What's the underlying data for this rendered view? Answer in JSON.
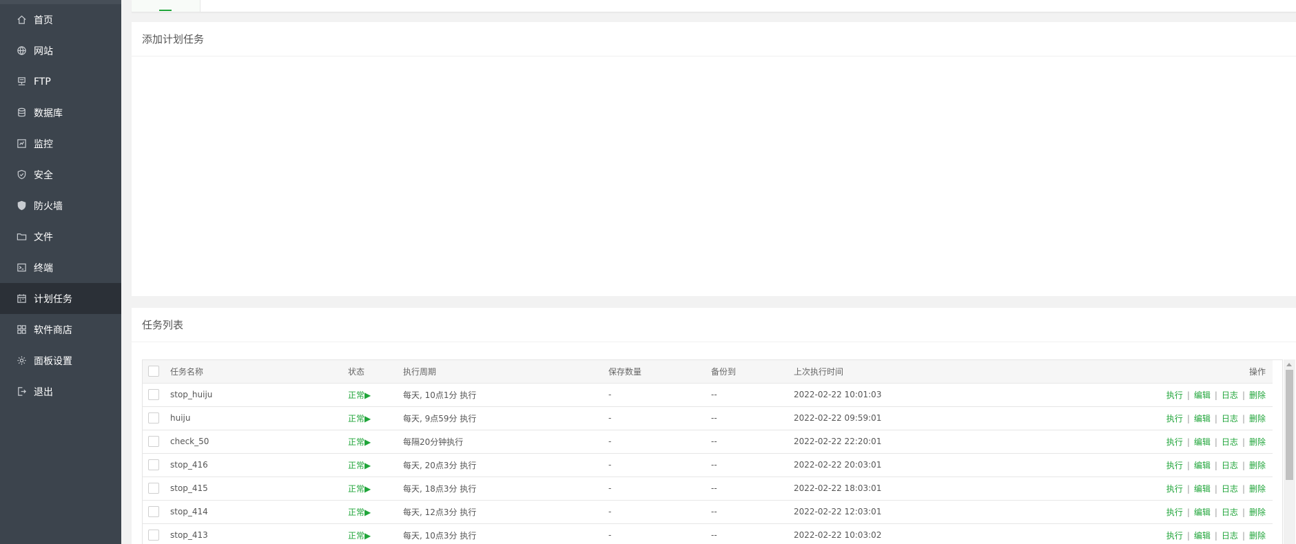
{
  "sidebar": {
    "items": [
      {
        "label": "首页",
        "icon": "home-icon"
      },
      {
        "label": "网站",
        "icon": "globe-icon"
      },
      {
        "label": "FTP",
        "icon": "ftp-icon"
      },
      {
        "label": "数据库",
        "icon": "database-icon"
      },
      {
        "label": "监控",
        "icon": "monitor-icon"
      },
      {
        "label": "安全",
        "icon": "shield-icon"
      },
      {
        "label": "防火墙",
        "icon": "firewall-icon"
      },
      {
        "label": "文件",
        "icon": "folder-icon"
      },
      {
        "label": "终端",
        "icon": "terminal-icon"
      },
      {
        "label": "计划任务",
        "icon": "calendar-icon",
        "active": true
      },
      {
        "label": "软件商店",
        "icon": "apps-icon"
      },
      {
        "label": "面板设置",
        "icon": "gear-icon"
      },
      {
        "label": "退出",
        "icon": "logout-icon"
      }
    ]
  },
  "add_panel": {
    "title": "添加计划任务"
  },
  "list_panel": {
    "title": "任务列表",
    "columns": {
      "name": "任务名称",
      "status": "状态",
      "cycle": "执行周期",
      "keep": "保存数量",
      "backup": "备份到",
      "last_run": "上次执行时间",
      "ops": "操作"
    },
    "ops": {
      "run": "执行",
      "edit": "编辑",
      "log": "日志",
      "delete": "删除",
      "sep": "|"
    },
    "rows": [
      {
        "name": "stop_huiju",
        "status": "正常▶",
        "cycle": "每天, 10点1分 执行",
        "keep": "-",
        "backup": "--",
        "last_run": "2022-02-22 10:01:03"
      },
      {
        "name": "huiju",
        "status": "正常▶",
        "cycle": "每天, 9点59分 执行",
        "keep": "-",
        "backup": "--",
        "last_run": "2022-02-22 09:59:01"
      },
      {
        "name": "check_50",
        "status": "正常▶",
        "cycle": "每隔20分钟执行",
        "keep": "-",
        "backup": "--",
        "last_run": "2022-02-22 22:20:01"
      },
      {
        "name": "stop_416",
        "status": "正常▶",
        "cycle": "每天, 20点3分 执行",
        "keep": "-",
        "backup": "--",
        "last_run": "2022-02-22 20:03:01"
      },
      {
        "name": "stop_415",
        "status": "正常▶",
        "cycle": "每天, 18点3分 执行",
        "keep": "-",
        "backup": "--",
        "last_run": "2022-02-22 18:03:01"
      },
      {
        "name": "stop_414",
        "status": "正常▶",
        "cycle": "每天, 12点3分 执行",
        "keep": "-",
        "backup": "--",
        "last_run": "2022-02-22 12:03:01"
      },
      {
        "name": "stop_413",
        "status": "正常▶",
        "cycle": "每天, 10点3分 执行",
        "keep": "-",
        "backup": "--",
        "last_run": "2022-02-22 10:03:02"
      }
    ]
  },
  "colors": {
    "sidebar_bg": "#3c444d",
    "sidebar_active": "#2b3037",
    "accent": "#20a53a"
  }
}
